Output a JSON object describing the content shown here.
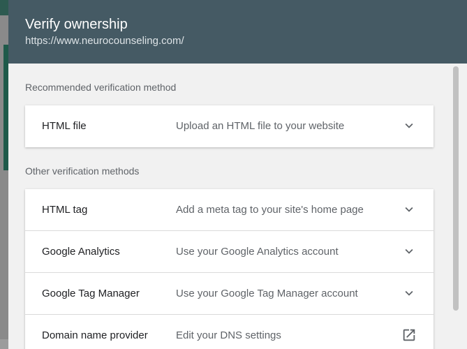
{
  "dialog": {
    "title": "Verify ownership",
    "subtitle": "https://www.neurocounseling.com/"
  },
  "recommended": {
    "label": "Recommended verification method",
    "methods": [
      {
        "name": "HTML file",
        "description": "Upload an HTML file to your website",
        "icon": "chevron-down-icon"
      }
    ]
  },
  "other": {
    "label": "Other verification methods",
    "methods": [
      {
        "name": "HTML tag",
        "description": "Add a meta tag to your site's home page",
        "icon": "chevron-down-icon"
      },
      {
        "name": "Google Analytics",
        "description": "Use your Google Analytics account",
        "icon": "chevron-down-icon"
      },
      {
        "name": "Google Tag Manager",
        "description": "Use your Google Tag Manager account",
        "icon": "chevron-down-icon"
      },
      {
        "name": "Domain name provider",
        "description": "Edit your DNS settings",
        "icon": "open-in-new-icon"
      }
    ]
  },
  "colors": {
    "header": "#455a64",
    "dialog_bg": "#f1f1f1",
    "card_bg": "#ffffff"
  }
}
